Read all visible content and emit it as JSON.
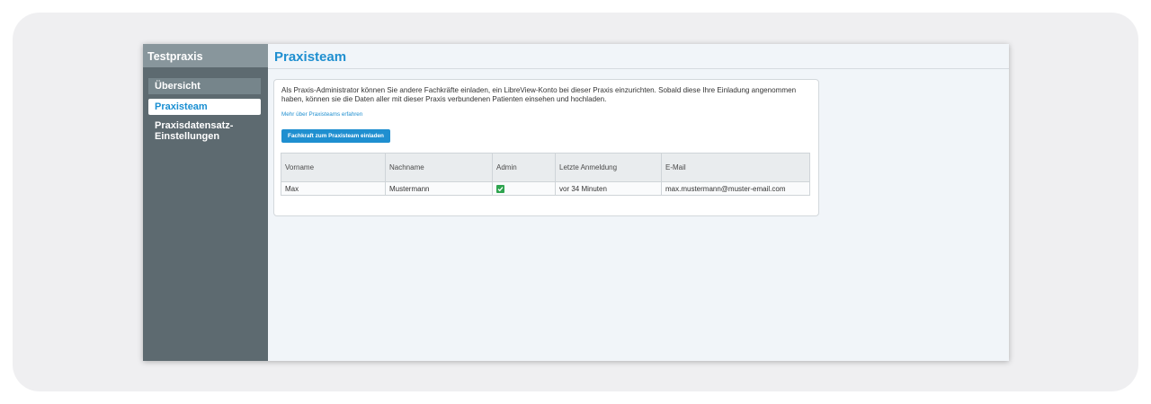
{
  "sidebar": {
    "title": "Testpraxis",
    "items": [
      {
        "label": "Übersicht"
      },
      {
        "label": "Praxisteam"
      },
      {
        "label": "Praxisdatensatz-Einstellungen"
      }
    ]
  },
  "main": {
    "title": "Praxisteam",
    "intro": "Als Praxis-Administrator können Sie andere Fachkräfte einladen, ein LibreView-Konto bei dieser Praxis einzurichten. Sobald diese Ihre Einladung angenommen haben, können sie die Daten aller mit dieser Praxis verbundenen Patienten einsehen und hochladen.",
    "learn_more": "Mehr über Praxisteams erfahren",
    "invite_button": "Fachkraft zum Praxisteam einladen",
    "table": {
      "headers": [
        "Vorname",
        "Nachname",
        "Admin",
        "Letzte Anmeldung",
        "E-Mail"
      ],
      "rows": [
        {
          "first": "Max",
          "last": "Mustermann",
          "admin": true,
          "last_login": "vor 34 Minuten",
          "email": "max.mustermann@muster-email.com"
        }
      ]
    }
  },
  "colors": {
    "accent": "#1f8fd0",
    "sidebar": "#5d6a70",
    "check": "#2ea44f"
  }
}
